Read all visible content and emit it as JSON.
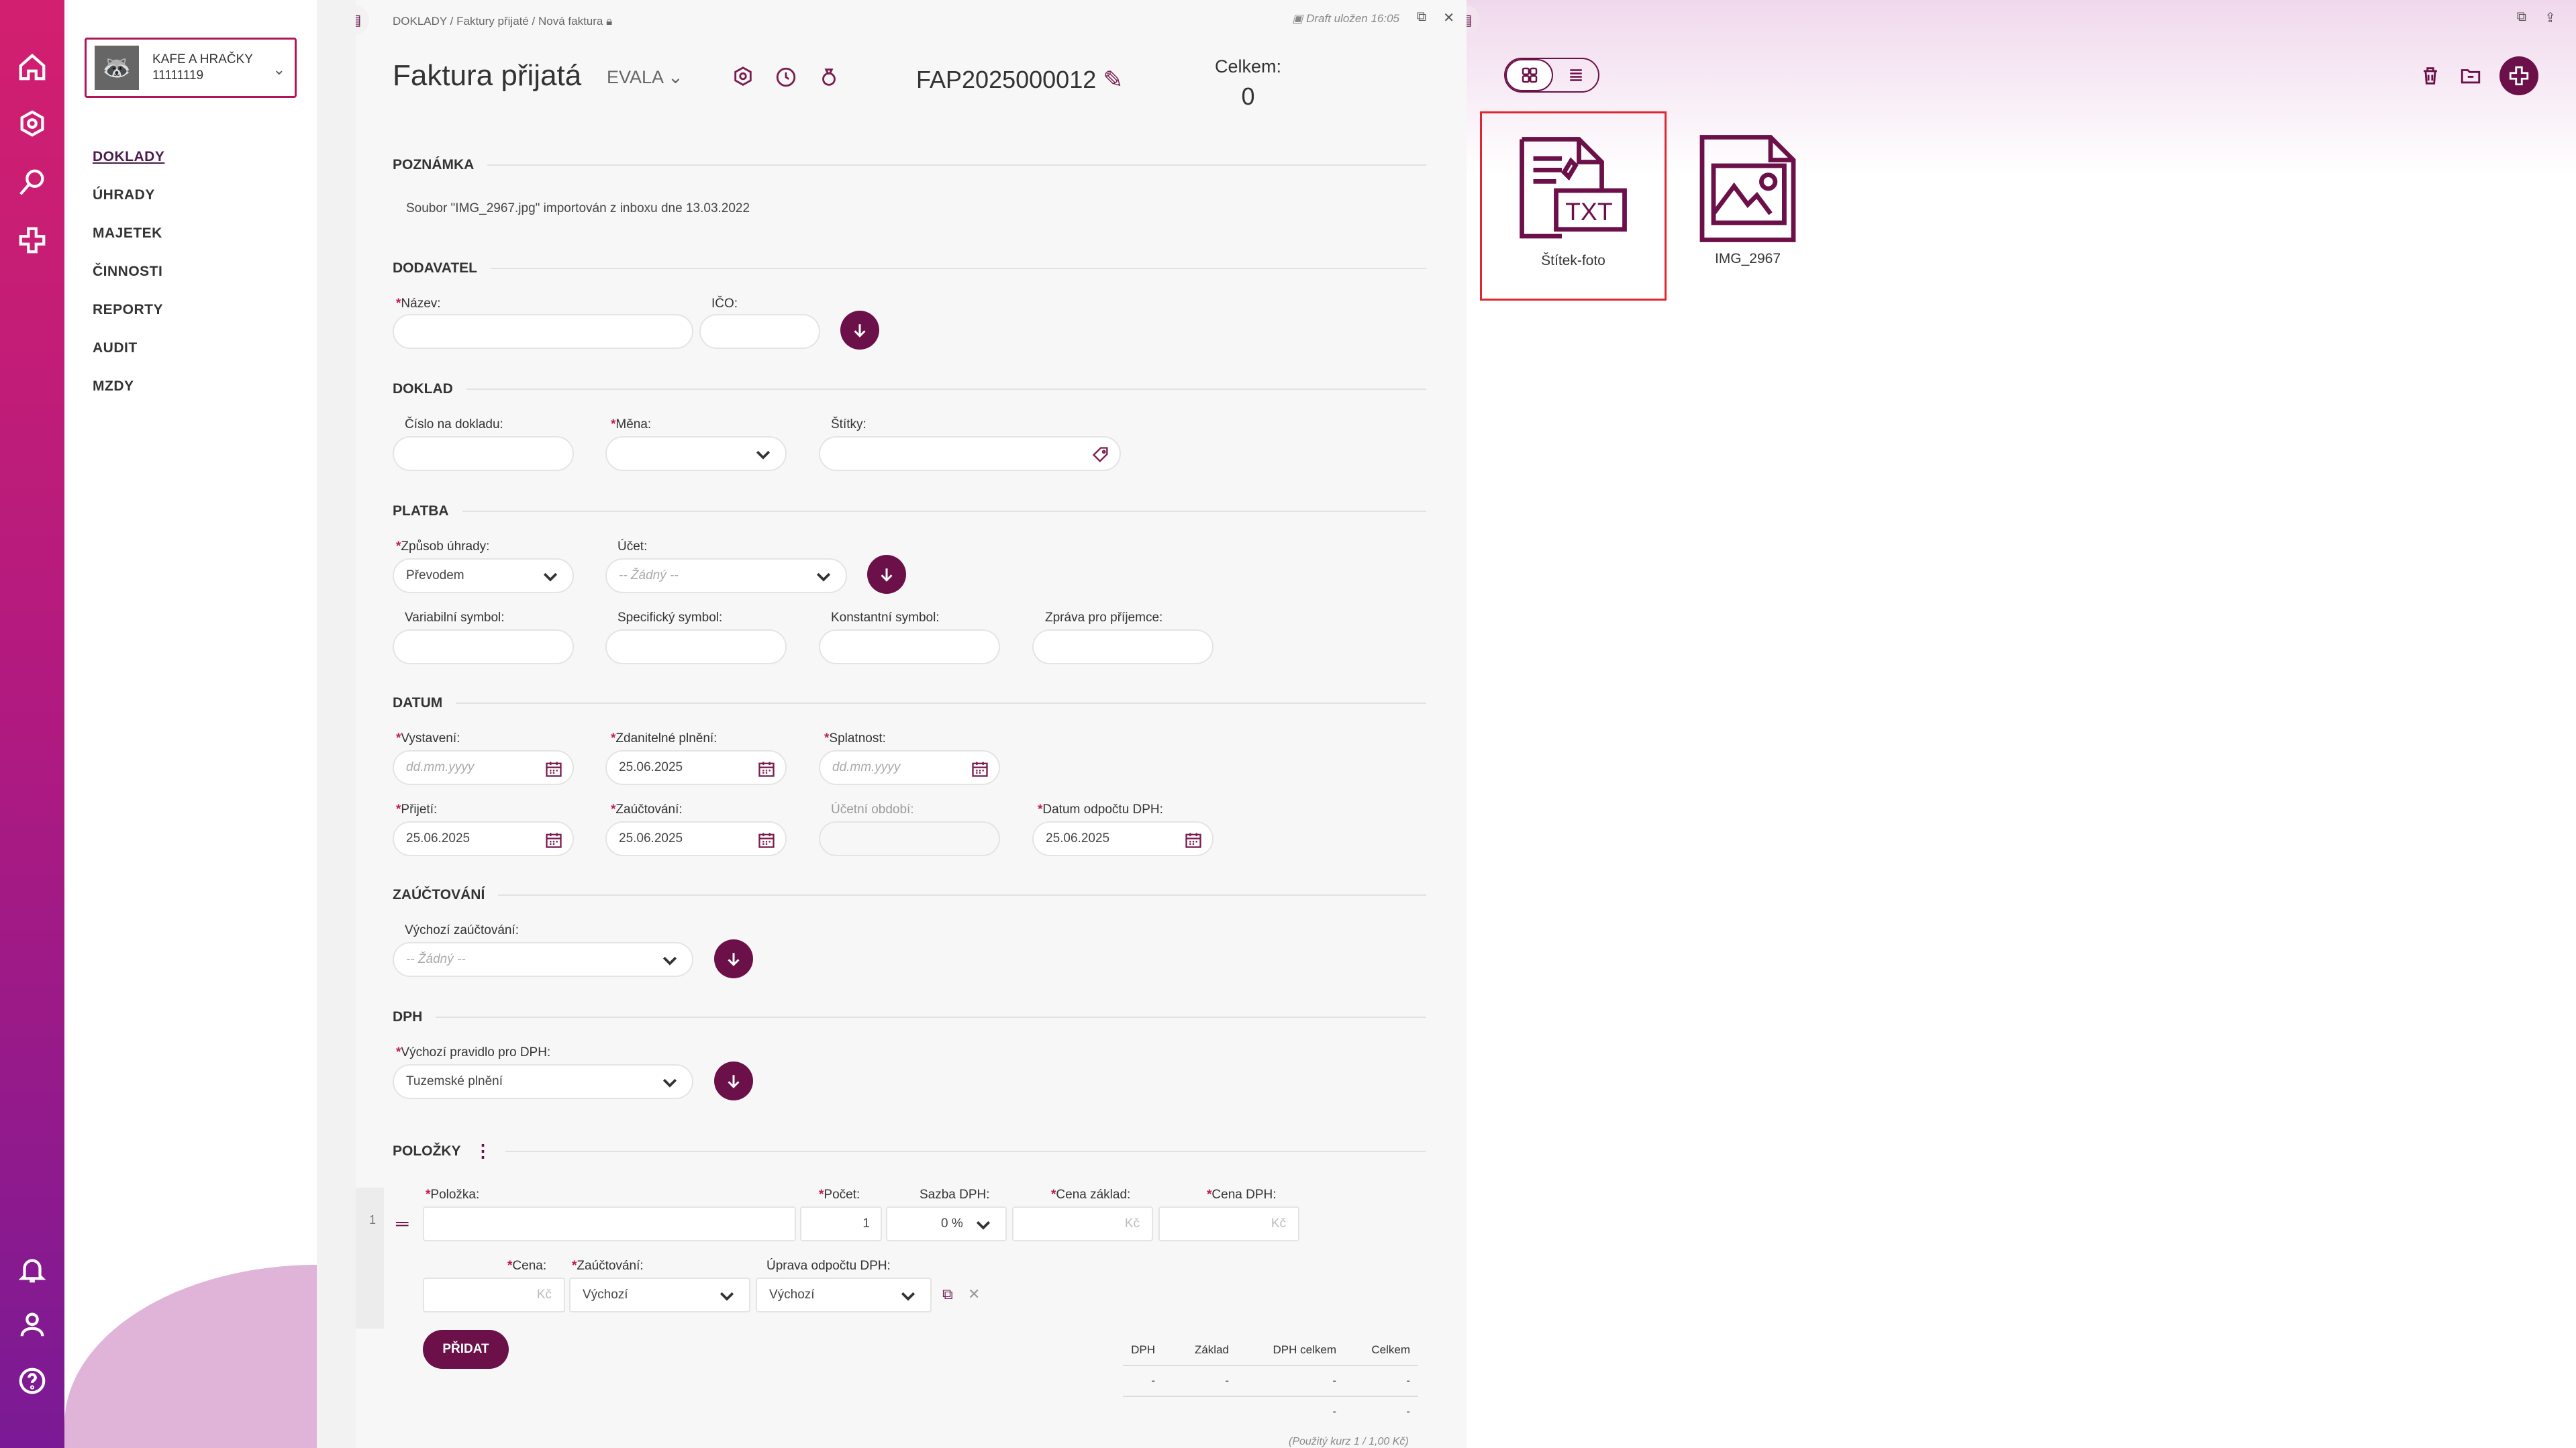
{
  "company": {
    "name": "KAFE A HRAČKY",
    "id": "11111119"
  },
  "menu": [
    "DOKLADY",
    "ÚHRADY",
    "MAJETEK",
    "ČINNOSTI",
    "REPORTY",
    "AUDIT",
    "MZDY"
  ],
  "breadcrumb": {
    "part1": "DOKLADY",
    "part2": "Faktury přijaté",
    "part3": "Nová faktura"
  },
  "draft": "Draft uložen 16:05",
  "header": {
    "title": "Faktura přijatá",
    "series": "EVALA",
    "doc_number": "FAP2025000012",
    "total_label": "Celkem:",
    "total_value": "0"
  },
  "sections": {
    "note": "POZNÁMKA",
    "supplier": "DODAVATEL",
    "doc": "DOKLAD",
    "payment": "PLATBA",
    "date": "DATUM",
    "posting": "ZAÚČTOVÁNÍ",
    "vat": "DPH",
    "items": "POLOŽKY"
  },
  "note_text": "Soubor \"IMG_2967.jpg\" importován z inboxu dne 13.03.2022",
  "supplier": {
    "name_label": "Název:",
    "ico_label": "IČO:"
  },
  "doc": {
    "number_label": "Číslo na dokladu:",
    "currency_label": "Měna:",
    "tags_label": "Štítky:"
  },
  "payment": {
    "method_label": "Způsob úhrady:",
    "method_value": "Převodem",
    "account_label": "Účet:",
    "account_value": "-- Žádný --",
    "vs_label": "Variabilní symbol:",
    "ss_label": "Specifický symbol:",
    "ks_label": "Konstantní symbol:",
    "msg_label": "Zpráva pro příjemce:"
  },
  "dates": {
    "issue_label": "Vystavení:",
    "issue_ph": "dd.mm.yyyy",
    "taxable_label": "Zdanitelné plnění:",
    "taxable_value": "25.06.2025",
    "due_label": "Splatnost:",
    "due_ph": "dd.mm.yyyy",
    "received_label": "Přijetí:",
    "received_value": "25.06.2025",
    "posting_label": "Zaúčtování:",
    "posting_value": "25.06.2025",
    "period_label": "Účetní období:",
    "vat_ded_label": "Datum odpočtu DPH:",
    "vat_ded_value": "25.06.2025"
  },
  "posting": {
    "default_label": "Výchozí zaúčtování:",
    "default_value": "-- Žádný --"
  },
  "vat": {
    "rule_label": "Výchozí pravidlo pro DPH:",
    "rule_value": "Tuzemské plnění"
  },
  "items": {
    "row_no": "1",
    "item_label": "Položka:",
    "qty_label": "Počet:",
    "qty_value": "1",
    "rate_label": "Sazba DPH:",
    "rate_value": "0 %",
    "base_label": "Cena základ:",
    "vatprice_label": "Cena DPH:",
    "currency": "Kč",
    "price_label": "Cena:",
    "posting_label": "Zaúčtování:",
    "posting_value": "Výchozí",
    "vatadj_label": "Úprava odpočtu DPH:",
    "vatadj_value": "Výchozí",
    "add_button": "PŘIDAT"
  },
  "summary": {
    "headers": [
      "DPH",
      "Základ",
      "DPH celkem",
      "Celkem"
    ],
    "row1": [
      "-",
      "-",
      "-",
      "-"
    ],
    "row2": [
      "",
      "",
      "-",
      "-"
    ],
    "footnote": "(Použitý kurz 1 / 1,00 Kč)"
  },
  "files": [
    {
      "name": "Štítek-foto",
      "icon": "txt-file-icon"
    },
    {
      "name": "IMG_2967",
      "icon": "image-file-icon"
    }
  ]
}
